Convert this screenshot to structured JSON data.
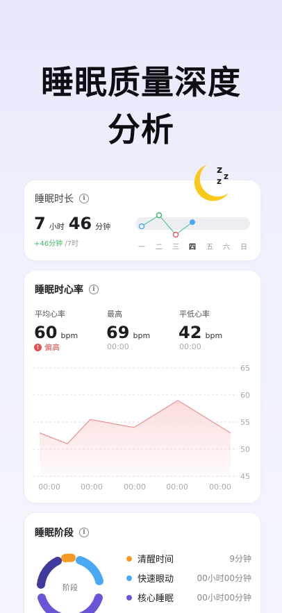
{
  "headline": {
    "line1": "睡眠质量深度",
    "line2": "分析"
  },
  "duration_card": {
    "title": "睡眠时长",
    "hours": "7",
    "hours_unit": "小时",
    "minutes": "46",
    "minutes_unit": "分钟",
    "delta": "+46分钟",
    "target": " /7时",
    "weekdays": [
      "一",
      "二",
      "三",
      "四",
      "五",
      "六",
      "日"
    ],
    "active_weekday": "四"
  },
  "heart_card": {
    "title": "睡眠时心率",
    "stats": [
      {
        "label": "平均心率",
        "value": "60",
        "unit": "bpm",
        "note": "偏高"
      },
      {
        "label": "最高",
        "value": "69",
        "unit": "bpm",
        "note": "00:00"
      },
      {
        "label": "平低心率",
        "value": "42",
        "unit": "bpm",
        "note": "00:00"
      }
    ],
    "chart_data": {
      "type": "area",
      "x": [
        "00:00",
        "00:00",
        "00:00",
        "00:00",
        "00:00"
      ],
      "y_ticks": [
        65,
        60,
        55,
        50,
        45
      ],
      "ylim": [
        45,
        65
      ],
      "values": [
        53,
        51,
        55.5,
        54,
        59,
        53
      ],
      "colors": {
        "line": "#e88f8f",
        "fill": "#fbd8d8"
      }
    }
  },
  "stage_card": {
    "title": "睡眠阶段",
    "center_label": "阶段",
    "legend": [
      {
        "label": "清醒时间",
        "value": "9分钟",
        "color": "#f59a23"
      },
      {
        "label": "快速眼动",
        "value": "00小时00分钟",
        "color": "#4aa8f5"
      },
      {
        "label": "核心睡眠",
        "value": "00小时00分钟",
        "color": "#6a55d9"
      }
    ]
  }
}
